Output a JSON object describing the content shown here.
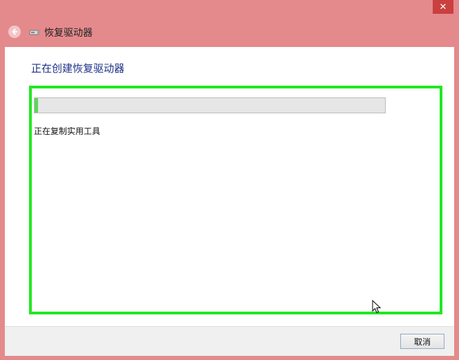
{
  "window": {
    "title": "恢复驱动器",
    "close_symbol": "✕"
  },
  "page": {
    "heading": "正在创建恢复驱动器",
    "progress_fraction": 0.01,
    "status": "正在复制实用工具"
  },
  "footer": {
    "cancel_label": "取消"
  },
  "colors": {
    "frame": "#e48a8c",
    "close": "#c9403f",
    "heading": "#1e3287",
    "highlight": "#20e820",
    "progress_fill": "#5bd65b"
  },
  "icons": {
    "back": "back-arrow-icon",
    "drive": "usb-drive-icon",
    "close": "close-icon",
    "cursor": "mouse-cursor-icon"
  }
}
